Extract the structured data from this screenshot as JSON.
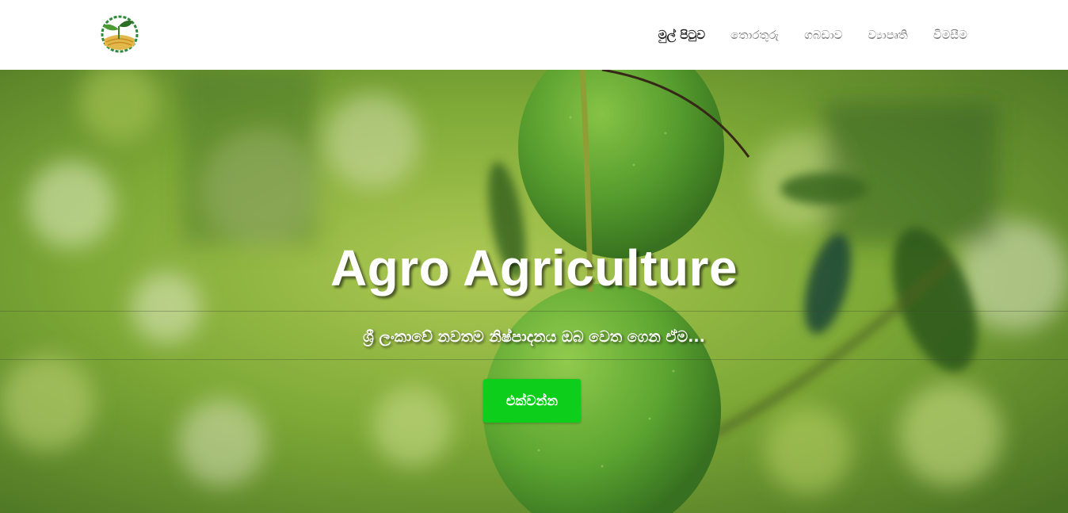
{
  "nav": {
    "links": [
      {
        "label": "මුල් පිටුව",
        "active": true
      },
      {
        "label": "තොරතුරු",
        "active": false
      },
      {
        "label": "ගබඩාව",
        "active": false
      },
      {
        "label": "ව්‍යාපෘති",
        "active": false
      },
      {
        "label": "විමසීම",
        "active": false
      }
    ]
  },
  "hero": {
    "title": "Agro Agriculture",
    "subtitle": "ශ්‍රී ලංකාවේ නවතම නිෂ්පාදනය ඔබ වෙත ගෙන ඒම...",
    "cta_label": "එක්වන්න"
  },
  "colors": {
    "accent": "#0dce1a",
    "nav_text": "#777777",
    "nav_active": "#222222"
  }
}
